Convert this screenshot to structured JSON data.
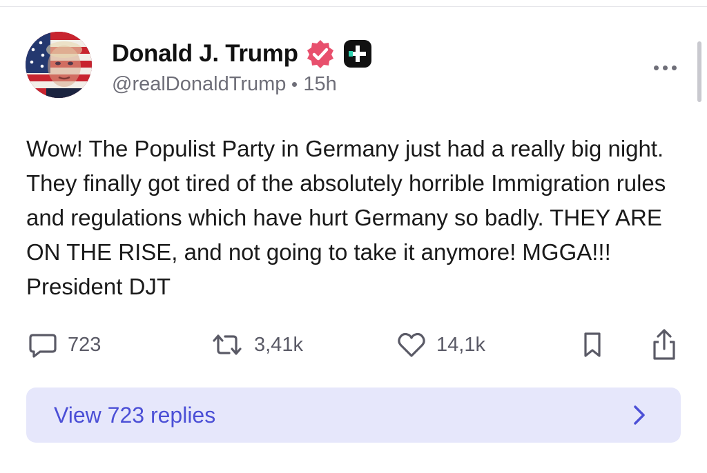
{
  "post": {
    "author": {
      "display_name": "Donald J. Trump",
      "handle": "@realDonaldTrump",
      "verified_icon": "verified-badge-icon",
      "plus_icon": "plus-badge-icon"
    },
    "time_ago": "15h",
    "text": "Wow! The Populist Party in Germany just had a really big night. They finally got tired of the absolutely horrible Immigration rules and regulations which have hurt Germany so badly. THEY ARE ON THE RISE, and not going to take it anymore! MGGA!!! President DJT",
    "actions": {
      "replies_count": "723",
      "reposts_count": "3,41k",
      "likes_count": "14,1k"
    },
    "view_replies_label": "View 723 replies"
  },
  "colors": {
    "verified_badge": "#e8506d",
    "plus_badge": "#111111",
    "accent": "#4b4fd6",
    "replies_bg": "#e6e7fb",
    "muted": "#6e6e78"
  },
  "icons": [
    "more-icon",
    "comment-icon",
    "repost-icon",
    "heart-icon",
    "bookmark-icon",
    "share-icon",
    "chevron-right-icon"
  ]
}
